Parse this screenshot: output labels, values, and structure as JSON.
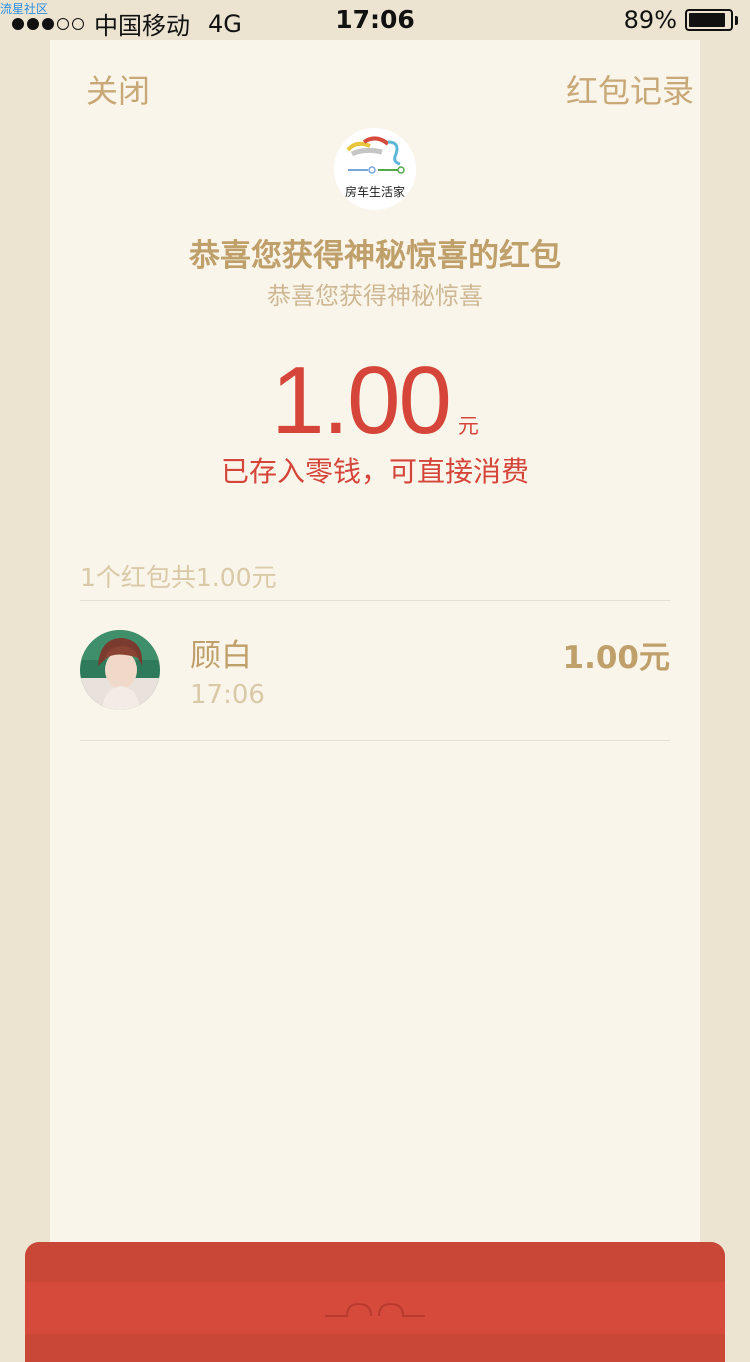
{
  "status_bar": {
    "carrier": "中国移动",
    "network": "4G",
    "time": "17:06",
    "battery": "89%",
    "battery_level": 0.89,
    "watermark": "流星社区"
  },
  "nav": {
    "close_label": "关闭",
    "records_label": "红包记录"
  },
  "logo": {
    "text": "房车生活家",
    "icon": "rv-logo-icon"
  },
  "main": {
    "title": "恭喜您获得神秘惊喜的红包",
    "subtitle": "恭喜您获得神秘惊喜",
    "amount": "1.00",
    "unit": "元",
    "stored_note": "已存入零钱，可直接消费"
  },
  "list": {
    "summary": "1个红包共1.00元",
    "items": [
      {
        "name": "顾白",
        "time": "17:06",
        "amount": "1.00元"
      }
    ]
  },
  "colors": {
    "background": "#ece3d1",
    "card": "#faf5ea",
    "gold": "#bf9f6a",
    "red": "#d5453a"
  }
}
